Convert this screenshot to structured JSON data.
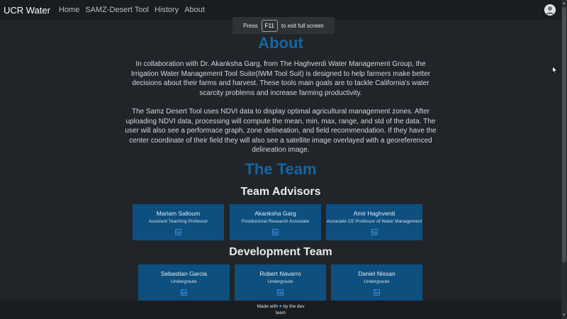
{
  "navbar": {
    "brand": "UCR Water",
    "links": [
      "Home",
      "SAMZ-Desert Tool",
      "History",
      "About"
    ]
  },
  "toast": {
    "prefix": "Press",
    "key": "F11",
    "suffix": "to exit full screen"
  },
  "about": {
    "title": "About",
    "paragraph1": "In collaboration with Dr. Akanksha Garg, from The Haghverdi Water Management Group, the Irrigation Water Management Tool Suite(IWM Tool Suit) is designed to help farmers make better decisions about their farms and harvest. These tools main goals are to tackle California's water scarcity problems and increase farming productivity.",
    "paragraph2": "The Samz Desert Tool uses NDVI data to display optimal agricultural management zones. After uploading NDVI data, processing will compute the mean, min, max, range, and std of the data. The user will also see a performace graph, zone delineation, and field recommendation. If they have the center coordinate of their field they will also see a satellite image overlayed with a georeferenced delineation image."
  },
  "team": {
    "title": "The Team",
    "advisors_title": "Team Advisors",
    "advisors": [
      {
        "name": "Mariam Salloum",
        "role": "Assistant Teaching Professor"
      },
      {
        "name": "Akanksha Garg",
        "role": "Postdoctoral Research Associate"
      },
      {
        "name": "Amir Haghverdi",
        "role": "Associate CE Professor of Water Management"
      }
    ],
    "dev_title": "Development Team",
    "developers": [
      {
        "name": "Sebastian Garcia",
        "role": "Undergraute"
      },
      {
        "name": "Robert Navarro",
        "role": "Undergraute"
      },
      {
        "name": "Daniel Nissan",
        "role": "Undergraute"
      }
    ]
  },
  "footer": {
    "made_with": "Made with",
    "by_line": "by the dev",
    "team": "team"
  },
  "colors": {
    "accent": "#1565a0",
    "card": "#0d4f7e",
    "background": "#212529",
    "navbar": "#1a1d20"
  },
  "icons": [
    "user-avatar-icon",
    "linkedin-icon",
    "heart-icon",
    "mouse-cursor-icon"
  ]
}
